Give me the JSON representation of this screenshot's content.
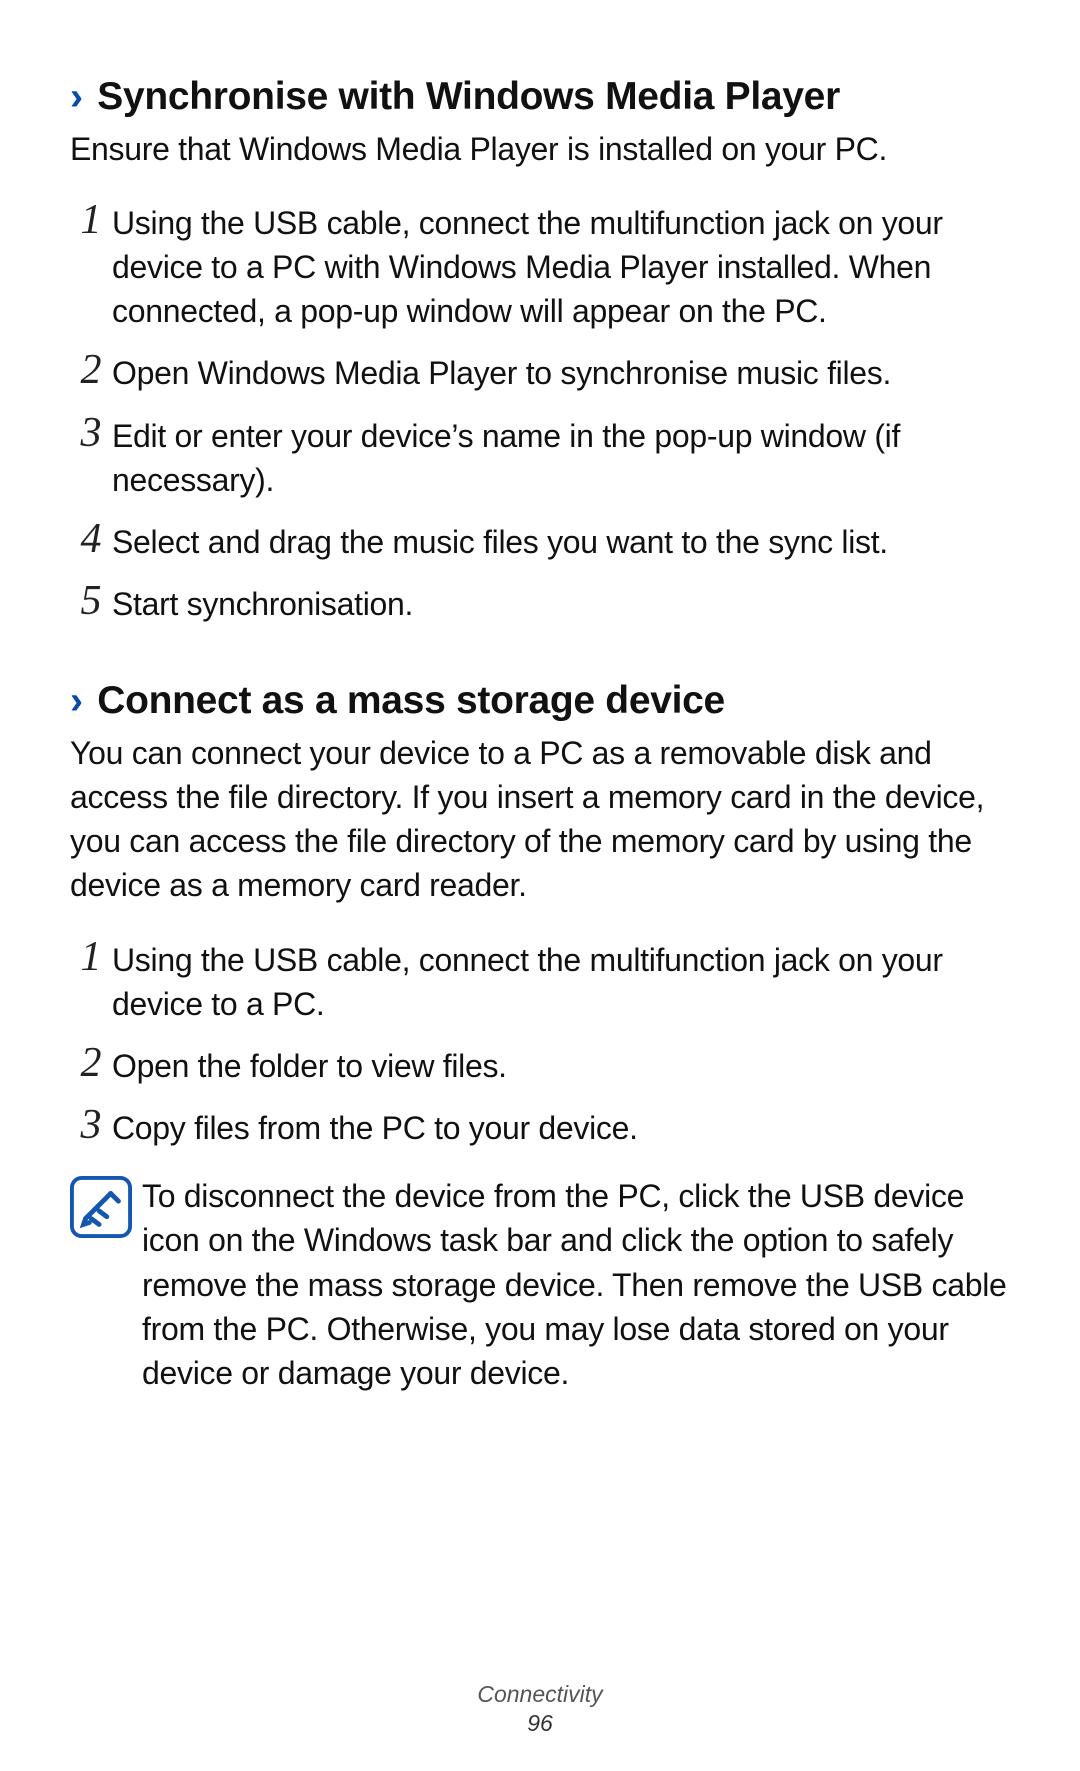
{
  "section1": {
    "title": "Synchronise with Windows Media Player",
    "intro": "Ensure that Windows Media Player is installed on your PC.",
    "steps": [
      "Using the USB cable, connect the multifunction jack on your device to a PC with Windows Media Player installed. When connected, a pop-up window will appear on the PC.",
      "Open Windows Media Player to synchronise music files.",
      "Edit or enter your device’s name in the pop-up window (if necessary).",
      "Select and drag the music files you want to the sync list.",
      "Start synchronisation."
    ]
  },
  "section2": {
    "title": "Connect as a mass storage device",
    "intro": "You can connect your device to a PC as a removable disk and access the file directory. If you insert a memory card in the device, you can access the file directory of the memory card by using the device as a memory card reader.",
    "steps": [
      "Using the USB cable, connect the multifunction jack on your device to a PC.",
      "Open the folder to view files.",
      "Copy files from the PC to your device."
    ],
    "note": "To disconnect the device from the PC, click the USB device icon on the Windows task bar and click the option to safely remove the mass storage device. Then remove the USB cable from the PC. Otherwise, you may lose data stored on your device or damage your device."
  },
  "step_numbers": [
    "1",
    "2",
    "3",
    "4",
    "5"
  ],
  "footer": {
    "section": "Connectivity",
    "page": "96"
  },
  "chevron": "›"
}
